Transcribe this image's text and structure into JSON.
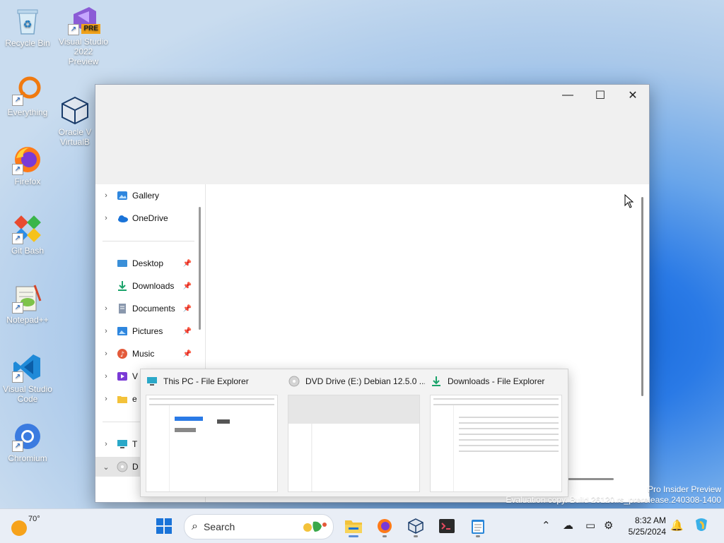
{
  "desktop": {
    "icons": [
      {
        "label": "Recycle Bin"
      },
      {
        "label": "Visual Studio 2022 Preview",
        "badge": "PRE"
      },
      {
        "label": "Everything"
      },
      {
        "label": "Oracle VM VirtualBox",
        "display": "Oracle V\nVirtualB"
      },
      {
        "label": "Firefox"
      },
      {
        "label": "Git Bash"
      },
      {
        "label": "Notepad++"
      },
      {
        "label": "Visual Studio Code"
      },
      {
        "label": "Chromium"
      }
    ]
  },
  "window": {
    "controls": {
      "minimize": "—",
      "maximize": "☐",
      "close": "✕"
    },
    "nav": {
      "items": [
        {
          "label": "Gallery",
          "expandable": true
        },
        {
          "label": "OneDrive",
          "expandable": true
        },
        {
          "label": "Desktop",
          "pinned": true
        },
        {
          "label": "Downloads",
          "pinned": true
        },
        {
          "label": "Documents",
          "pinned": true,
          "expandable": true
        },
        {
          "label": "Pictures",
          "pinned": true,
          "expandable": true
        },
        {
          "label": "Music",
          "pinned": true,
          "expandable": true
        },
        {
          "label": "V",
          "expandable": true
        },
        {
          "label": "e",
          "expandable": true
        },
        {
          "label": "T",
          "expandable": true
        },
        {
          "label": "D",
          "expanded": true
        }
      ]
    }
  },
  "thumbnails": [
    {
      "title": "This PC - File Explorer"
    },
    {
      "title": "DVD Drive (E:) Debian 12.5.0 ..."
    },
    {
      "title": "Downloads - File Explorer"
    }
  ],
  "watermark": {
    "line1": "Pro Insider Preview",
    "line2": "Evaluation copy. Build 26120.rs_prerelease.240308-1400"
  },
  "taskbar": {
    "weather": {
      "temp": "70°"
    },
    "search": {
      "placeholder": "Search"
    },
    "clock": {
      "time": "8:32 AM",
      "date": "5/25/2024"
    },
    "colors": {
      "accent": "#1a62c4",
      "taskbar_bg": "#e9eef6"
    }
  }
}
